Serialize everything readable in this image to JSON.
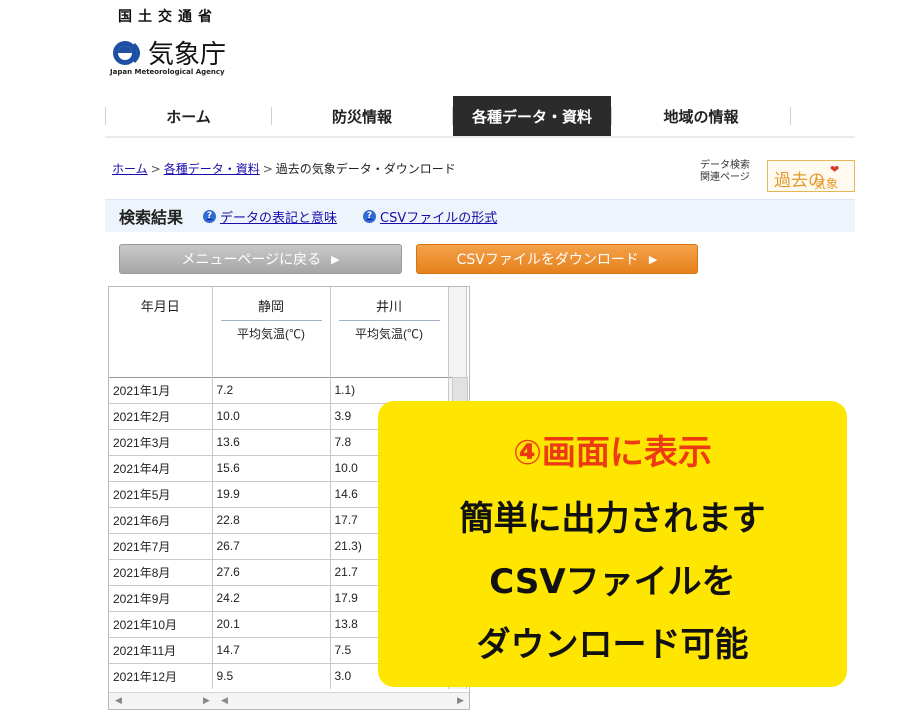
{
  "agency": {
    "ministry": "国土交通省",
    "name": "気象庁",
    "name_en": "Japan Meteorological Agency"
  },
  "nav": {
    "items": [
      {
        "label": "ホーム"
      },
      {
        "label": "防災情報"
      },
      {
        "label": "各種データ・資料"
      },
      {
        "label": "地域の情報"
      }
    ],
    "active_index": 2
  },
  "breadcrumb": {
    "home": "ホーム",
    "section": "各種データ・資料",
    "current": "過去の気象データ・ダウンロード",
    "separator": ">"
  },
  "related": {
    "line1": "データ検索",
    "line2": "関連ページ",
    "banner_text": "過去の",
    "banner_sub": "気象"
  },
  "results": {
    "title": "検索結果",
    "link1": "データの表記と意味",
    "link2": "CSVファイルの形式"
  },
  "buttons": {
    "back": "メニューページに戻る",
    "download": "CSVファイルをダウンロード",
    "arrow": "▶"
  },
  "table": {
    "date_header": "年月日",
    "stations": [
      {
        "name": "静岡",
        "element": "平均気温(℃)"
      },
      {
        "name": "井川",
        "element": "平均気温(℃)"
      }
    ],
    "rows": [
      {
        "date": "2021年1月",
        "v1": "7.2",
        "v2": "1.1)"
      },
      {
        "date": "2021年2月",
        "v1": "10.0",
        "v2": "3.9"
      },
      {
        "date": "2021年3月",
        "v1": "13.6",
        "v2": "7.8"
      },
      {
        "date": "2021年4月",
        "v1": "15.6",
        "v2": "10.0"
      },
      {
        "date": "2021年5月",
        "v1": "19.9",
        "v2": "14.6"
      },
      {
        "date": "2021年6月",
        "v1": "22.8",
        "v2": "17.7"
      },
      {
        "date": "2021年7月",
        "v1": "26.7",
        "v2": "21.3)"
      },
      {
        "date": "2021年8月",
        "v1": "27.6",
        "v2": "21.7"
      },
      {
        "date": "2021年9月",
        "v1": "24.2",
        "v2": "17.9"
      },
      {
        "date": "2021年10月",
        "v1": "20.1",
        "v2": "13.8"
      },
      {
        "date": "2021年11月",
        "v1": "14.7",
        "v2": "7.5"
      },
      {
        "date": "2021年12月",
        "v1": "9.5",
        "v2": "3.0"
      }
    ]
  },
  "callout": {
    "line1": "④画面に表示",
    "line2": "簡単に出力されます",
    "line3": "CSVファイルを",
    "line4": "ダウンロード可能"
  },
  "colors": {
    "accent_orange": "#e6811c",
    "callout_bg": "#ffe600",
    "callout_red": "#ee3a12",
    "link_blue": "#1a0dab",
    "nav_active_bg": "#2b2b2b"
  }
}
